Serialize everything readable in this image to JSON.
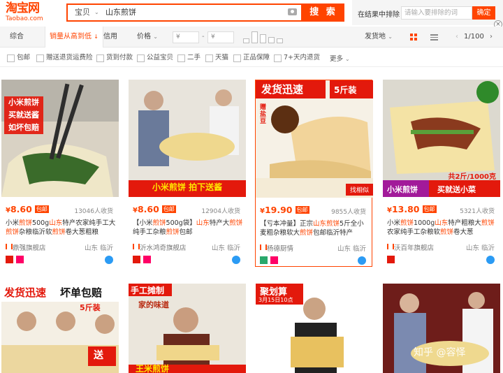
{
  "header": {
    "logo_cn": "淘宝网",
    "logo_en": "Taobao.com",
    "search_category": "宝贝",
    "search_query": "山东煎饼",
    "search_button": "搜 索",
    "in_results_label": "在结果中排除",
    "in_results_placeholder": "请输入要排除的词",
    "confirm": "确定"
  },
  "sort": {
    "items": [
      "综合",
      "销量从高到低",
      "信用",
      "价格"
    ],
    "price_from": "¥",
    "price_to": "¥",
    "dash": "-",
    "ship_from": "发货地",
    "page": "1/100"
  },
  "filters": [
    "包邮",
    "赠送退货运费险",
    "货到付款",
    "公益宝贝",
    "二手",
    "天猫",
    "正品保障",
    "7+天内退货"
  ],
  "more": "更多",
  "products": [
    {
      "price": "8.60",
      "sales": "13046人收货",
      "title_parts": [
        "小米",
        "煎饼",
        "500g",
        "山东",
        "特产农家纯手工大",
        "煎饼",
        "杂粮临沂软",
        "煎饼",
        "卷大葱粗粮"
      ],
      "shop": "鼎强旗舰店",
      "location": "山东 临沂",
      "img_text": [
        "小米煎饼",
        "买就送酱",
        "如坏包赔"
      ]
    },
    {
      "price": "8.60",
      "sales": "12904人收货",
      "title_parts": [
        "【小米",
        "煎饼",
        "500g袋】",
        "山东",
        "特产大",
        "煎饼",
        "纯手工杂粮",
        "煎饼",
        "包邮"
      ],
      "shop": "沂水鸿奇旗舰店",
      "location": "山东 临沂",
      "img_text": [
        "小米煎饼  拍下送酱"
      ]
    },
    {
      "price": "19.90",
      "sales": "9855人收货",
      "title_parts": [
        "【亏本冲量】正宗",
        "山东",
        "煎饼",
        "5斤全小麦粗杂粮软大",
        "煎饼",
        "包邮临沂特产",
        "",
        "",
        ""
      ],
      "shop": "杨德厨情",
      "location": "山东 临沂",
      "img_text": [
        "发货迅速",
        "5斤装",
        "赠盐豆",
        "找相似"
      ]
    },
    {
      "price": "13.80",
      "sales": "5321人收货",
      "title_parts": [
        "小米",
        "煎饼",
        "1000g",
        "山东",
        "特产粗粮大",
        "煎饼",
        "农家纯手工杂粮软",
        "煎饼",
        "卷大葱"
      ],
      "shop": "沃百年旗舰店",
      "location": "山东 临沂",
      "img_text": [
        "共2斤/1000克",
        "小米煎饼",
        "买就送小菜"
      ]
    }
  ],
  "row2": [
    {
      "img_text": [
        "发货迅速",
        "坏单包赔",
        "5斤装",
        "送"
      ]
    },
    {
      "img_text": [
        "手工摊制",
        "家的味道",
        "王米煎饼"
      ]
    },
    {
      "img_text": [
        "聚划算",
        "3月15日10点"
      ]
    },
    {
      "img_text": [
        "知乎 @容怿"
      ]
    }
  ],
  "colors": {
    "accent": "#ff4400",
    "bg_bar": "#f5f5f5"
  }
}
